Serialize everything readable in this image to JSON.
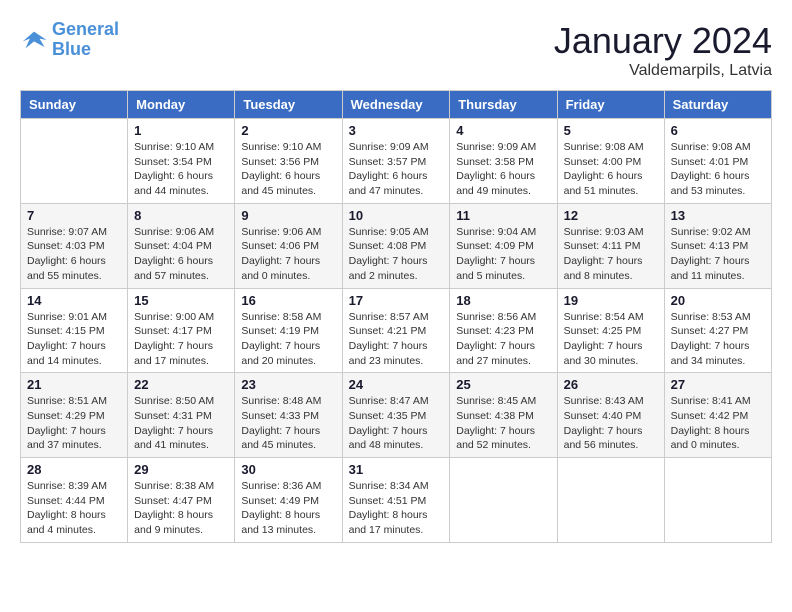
{
  "header": {
    "logo_line1": "General",
    "logo_line2": "Blue",
    "month_title": "January 2024",
    "location": "Valdemarpils, Latvia"
  },
  "weekdays": [
    "Sunday",
    "Monday",
    "Tuesday",
    "Wednesday",
    "Thursday",
    "Friday",
    "Saturday"
  ],
  "weeks": [
    [
      {
        "day": "",
        "info": ""
      },
      {
        "day": "1",
        "info": "Sunrise: 9:10 AM\nSunset: 3:54 PM\nDaylight: 6 hours\nand 44 minutes."
      },
      {
        "day": "2",
        "info": "Sunrise: 9:10 AM\nSunset: 3:56 PM\nDaylight: 6 hours\nand 45 minutes."
      },
      {
        "day": "3",
        "info": "Sunrise: 9:09 AM\nSunset: 3:57 PM\nDaylight: 6 hours\nand 47 minutes."
      },
      {
        "day": "4",
        "info": "Sunrise: 9:09 AM\nSunset: 3:58 PM\nDaylight: 6 hours\nand 49 minutes."
      },
      {
        "day": "5",
        "info": "Sunrise: 9:08 AM\nSunset: 4:00 PM\nDaylight: 6 hours\nand 51 minutes."
      },
      {
        "day": "6",
        "info": "Sunrise: 9:08 AM\nSunset: 4:01 PM\nDaylight: 6 hours\nand 53 minutes."
      }
    ],
    [
      {
        "day": "7",
        "info": "Sunrise: 9:07 AM\nSunset: 4:03 PM\nDaylight: 6 hours\nand 55 minutes."
      },
      {
        "day": "8",
        "info": "Sunrise: 9:06 AM\nSunset: 4:04 PM\nDaylight: 6 hours\nand 57 minutes."
      },
      {
        "day": "9",
        "info": "Sunrise: 9:06 AM\nSunset: 4:06 PM\nDaylight: 7 hours\nand 0 minutes."
      },
      {
        "day": "10",
        "info": "Sunrise: 9:05 AM\nSunset: 4:08 PM\nDaylight: 7 hours\nand 2 minutes."
      },
      {
        "day": "11",
        "info": "Sunrise: 9:04 AM\nSunset: 4:09 PM\nDaylight: 7 hours\nand 5 minutes."
      },
      {
        "day": "12",
        "info": "Sunrise: 9:03 AM\nSunset: 4:11 PM\nDaylight: 7 hours\nand 8 minutes."
      },
      {
        "day": "13",
        "info": "Sunrise: 9:02 AM\nSunset: 4:13 PM\nDaylight: 7 hours\nand 11 minutes."
      }
    ],
    [
      {
        "day": "14",
        "info": "Sunrise: 9:01 AM\nSunset: 4:15 PM\nDaylight: 7 hours\nand 14 minutes."
      },
      {
        "day": "15",
        "info": "Sunrise: 9:00 AM\nSunset: 4:17 PM\nDaylight: 7 hours\nand 17 minutes."
      },
      {
        "day": "16",
        "info": "Sunrise: 8:58 AM\nSunset: 4:19 PM\nDaylight: 7 hours\nand 20 minutes."
      },
      {
        "day": "17",
        "info": "Sunrise: 8:57 AM\nSunset: 4:21 PM\nDaylight: 7 hours\nand 23 minutes."
      },
      {
        "day": "18",
        "info": "Sunrise: 8:56 AM\nSunset: 4:23 PM\nDaylight: 7 hours\nand 27 minutes."
      },
      {
        "day": "19",
        "info": "Sunrise: 8:54 AM\nSunset: 4:25 PM\nDaylight: 7 hours\nand 30 minutes."
      },
      {
        "day": "20",
        "info": "Sunrise: 8:53 AM\nSunset: 4:27 PM\nDaylight: 7 hours\nand 34 minutes."
      }
    ],
    [
      {
        "day": "21",
        "info": "Sunrise: 8:51 AM\nSunset: 4:29 PM\nDaylight: 7 hours\nand 37 minutes."
      },
      {
        "day": "22",
        "info": "Sunrise: 8:50 AM\nSunset: 4:31 PM\nDaylight: 7 hours\nand 41 minutes."
      },
      {
        "day": "23",
        "info": "Sunrise: 8:48 AM\nSunset: 4:33 PM\nDaylight: 7 hours\nand 45 minutes."
      },
      {
        "day": "24",
        "info": "Sunrise: 8:47 AM\nSunset: 4:35 PM\nDaylight: 7 hours\nand 48 minutes."
      },
      {
        "day": "25",
        "info": "Sunrise: 8:45 AM\nSunset: 4:38 PM\nDaylight: 7 hours\nand 52 minutes."
      },
      {
        "day": "26",
        "info": "Sunrise: 8:43 AM\nSunset: 4:40 PM\nDaylight: 7 hours\nand 56 minutes."
      },
      {
        "day": "27",
        "info": "Sunrise: 8:41 AM\nSunset: 4:42 PM\nDaylight: 8 hours\nand 0 minutes."
      }
    ],
    [
      {
        "day": "28",
        "info": "Sunrise: 8:39 AM\nSunset: 4:44 PM\nDaylight: 8 hours\nand 4 minutes."
      },
      {
        "day": "29",
        "info": "Sunrise: 8:38 AM\nSunset: 4:47 PM\nDaylight: 8 hours\nand 9 minutes."
      },
      {
        "day": "30",
        "info": "Sunrise: 8:36 AM\nSunset: 4:49 PM\nDaylight: 8 hours\nand 13 minutes."
      },
      {
        "day": "31",
        "info": "Sunrise: 8:34 AM\nSunset: 4:51 PM\nDaylight: 8 hours\nand 17 minutes."
      },
      {
        "day": "",
        "info": ""
      },
      {
        "day": "",
        "info": ""
      },
      {
        "day": "",
        "info": ""
      }
    ]
  ]
}
